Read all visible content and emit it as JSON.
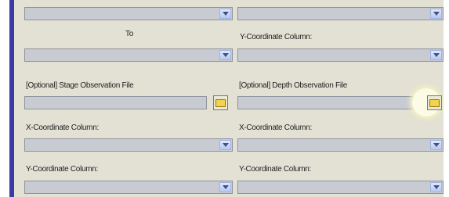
{
  "labels": {
    "to": "To",
    "y_coord_top_right": "Y-Coordinate Column:",
    "stage_obs_file": "[Optional] Stage Observation File",
    "depth_obs_file": "[Optional] Depth Observation File",
    "x_coord_left": "X-Coordinate Column:",
    "x_coord_right": "X-Coordinate Column:",
    "y_coord_left": "Y-Coordinate Column:",
    "y_coord_right": "Y-Coordinate Column:"
  },
  "icons": {
    "dropdown": "chevron-down-icon",
    "browse": "folder-icon"
  },
  "colors": {
    "accent_stripe": "#3b3ba8",
    "field_bg": "#c9cbd2",
    "highlight": "#fbfbe6"
  }
}
